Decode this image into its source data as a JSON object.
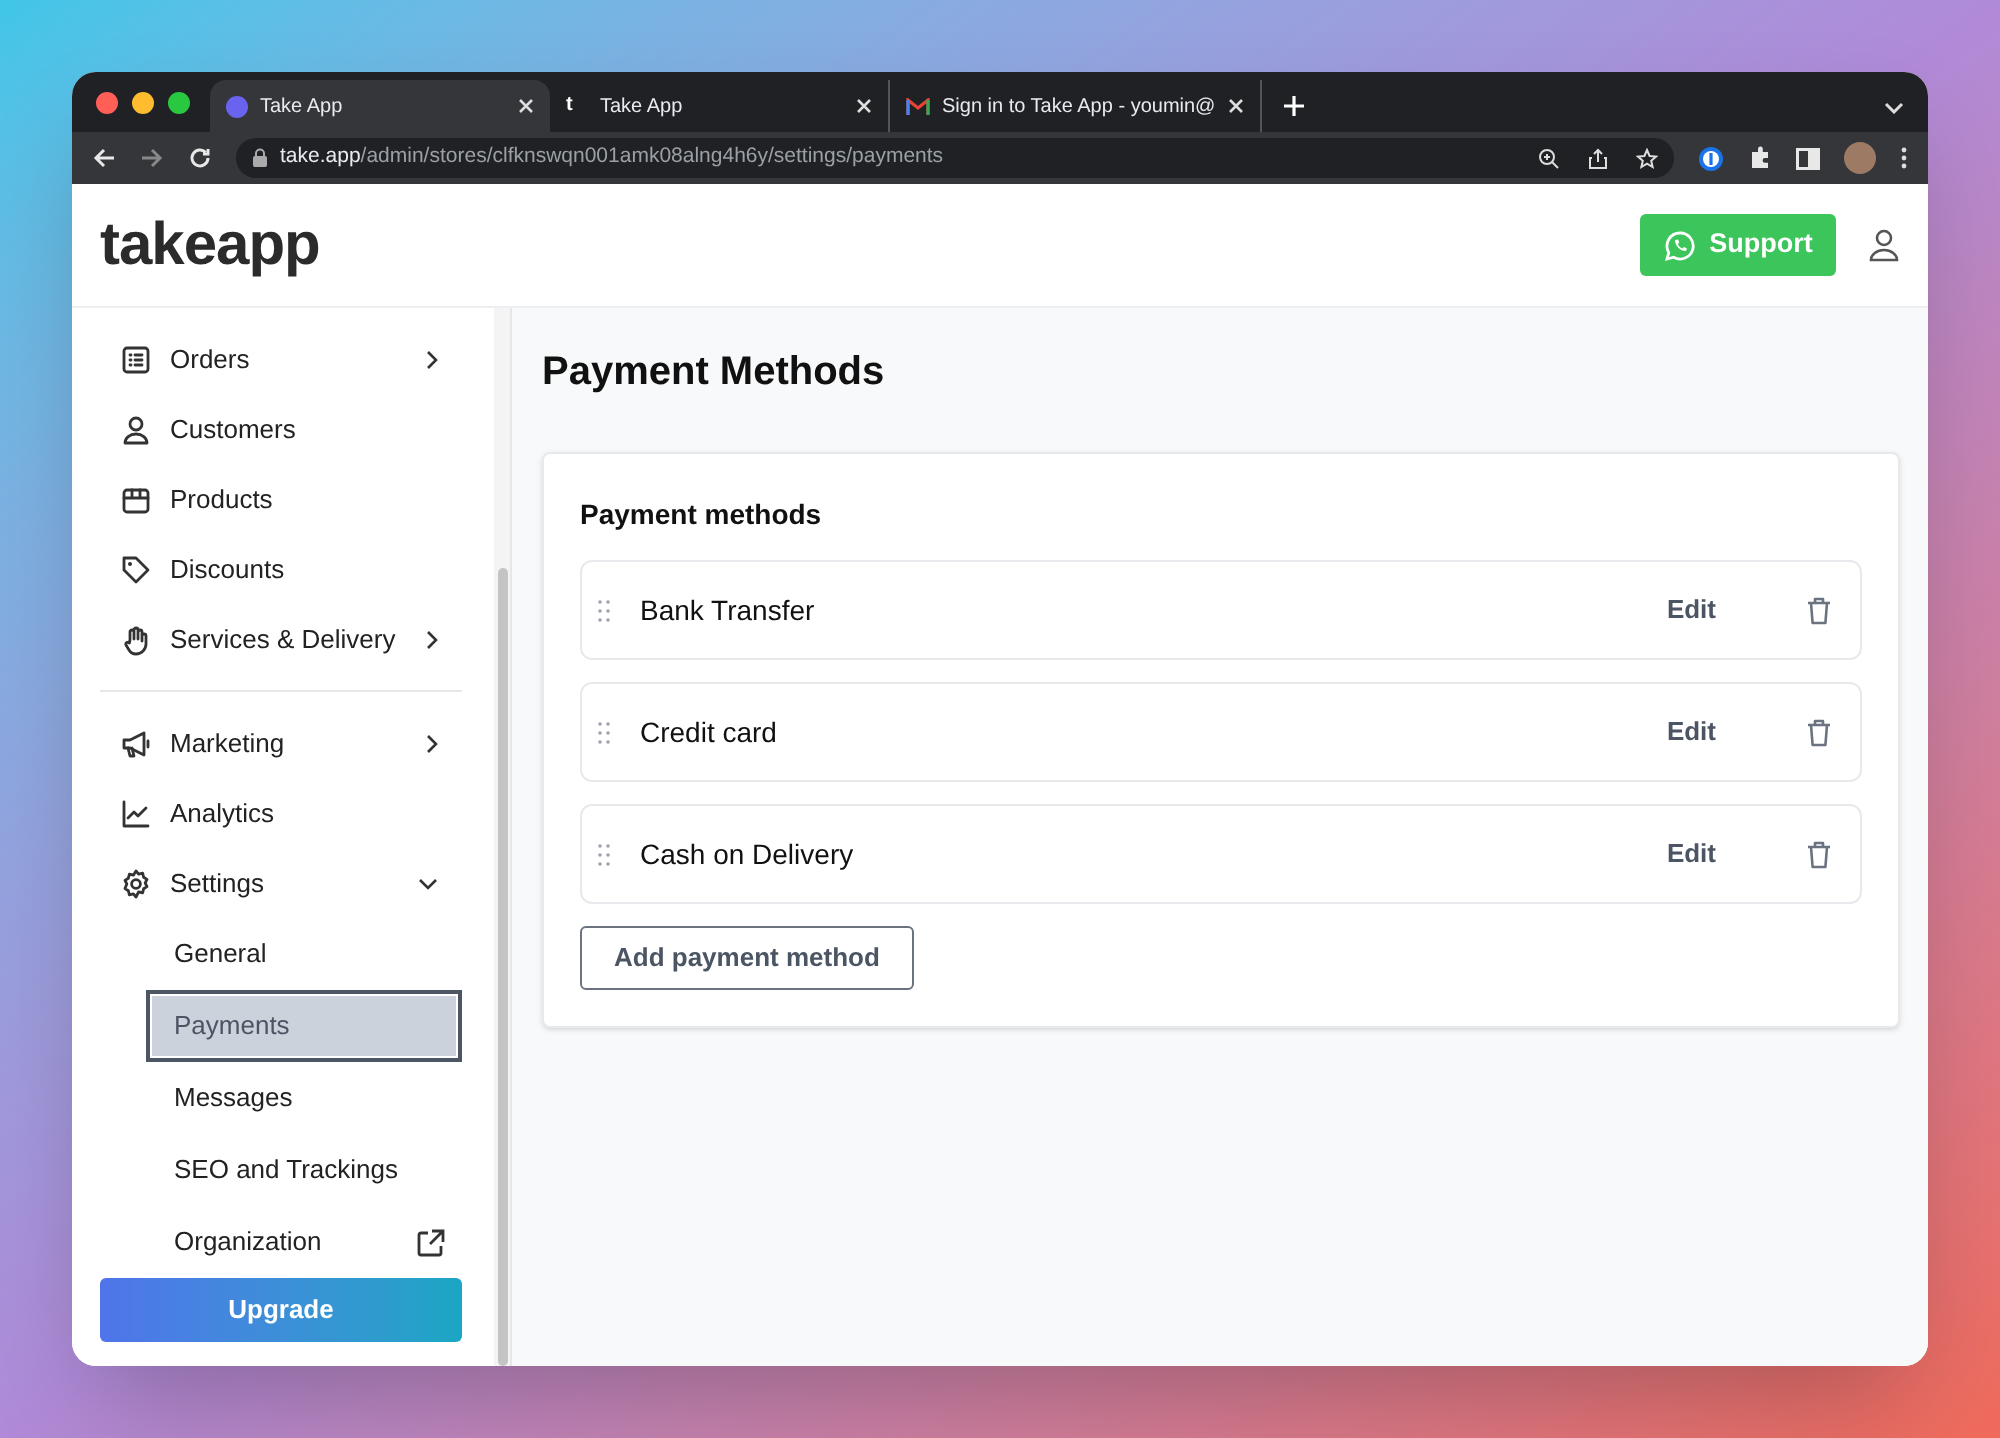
{
  "browser": {
    "tabs": [
      {
        "title": "Take App",
        "selected": true
      },
      {
        "title": "Take App",
        "letter": "t",
        "selected": false
      },
      {
        "title": "Sign in to Take App - youmin@",
        "selected": false
      }
    ],
    "url": {
      "host": "take.app",
      "path": "/admin/stores/clfknswqn001amk08alng4h6y/settings/payments"
    }
  },
  "header": {
    "logo": "takeapp",
    "support_button": "Support"
  },
  "sidebar": {
    "groups": [
      {
        "items": [
          {
            "label": "Orders",
            "expanded": false
          },
          {
            "label": "Customers"
          },
          {
            "label": "Products"
          },
          {
            "label": "Discounts"
          },
          {
            "label": "Services & Delivery",
            "expanded": false
          }
        ]
      },
      {
        "items": [
          {
            "label": "Marketing",
            "expanded": false
          },
          {
            "label": "Analytics"
          },
          {
            "label": "Settings",
            "expanded": true,
            "children": [
              {
                "label": "General",
                "kind": "link",
                "selected": false
              },
              {
                "label": "Payments",
                "kind": "link",
                "selected": true
              },
              {
                "label": "Messages",
                "kind": "link",
                "selected": false
              },
              {
                "label": "SEO and Trackings",
                "kind": "link",
                "selected": false
              },
              {
                "label": "Organization",
                "kind": "external",
                "selected": false
              }
            ]
          }
        ]
      }
    ],
    "upgrade_button": "Upgrade"
  },
  "page": {
    "title": "Payment Methods",
    "card": {
      "title": "Payment methods",
      "methods": [
        {
          "name": "Bank Transfer",
          "action": "Edit"
        },
        {
          "name": "Credit card",
          "action": "Edit"
        },
        {
          "name": "Cash on Delivery",
          "action": "Edit"
        }
      ],
      "add_button": "Add payment method"
    }
  }
}
